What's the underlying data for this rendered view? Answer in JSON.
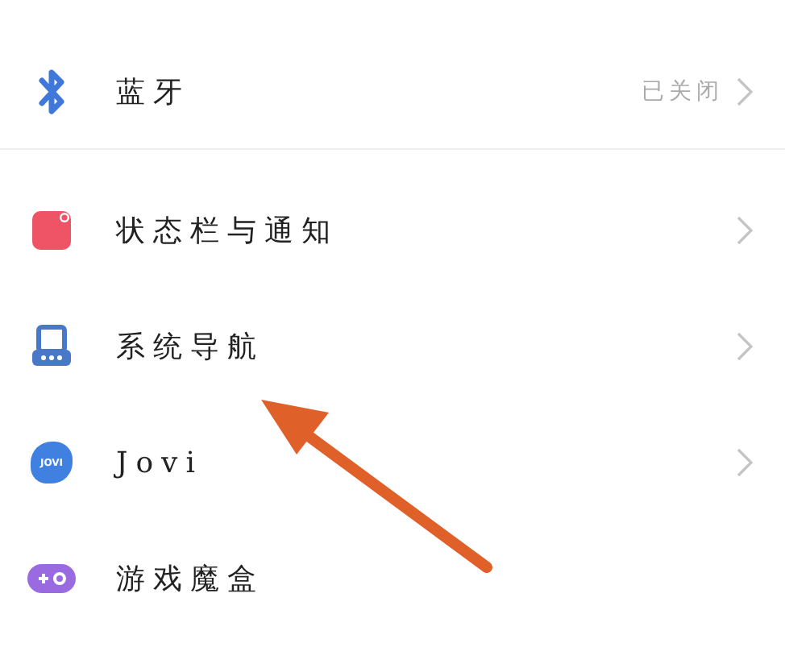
{
  "sections": [
    {
      "items": [
        {
          "kind": "bluetooth",
          "label": "蓝牙",
          "value": "已关闭",
          "chevron": true
        }
      ]
    },
    {
      "items": [
        {
          "kind": "statusbar",
          "label": "状态栏与通知",
          "chevron": true
        },
        {
          "kind": "navigation",
          "label": "系统导航",
          "chevron": true
        },
        {
          "kind": "jovi",
          "label": "Jovi",
          "icon_text": "JOVI",
          "chevron": true
        },
        {
          "kind": "gamebox",
          "label": "游戏魔盒",
          "chevron": false
        }
      ]
    }
  ],
  "annotation": {
    "kind": "arrow",
    "color": "#e0602a"
  }
}
